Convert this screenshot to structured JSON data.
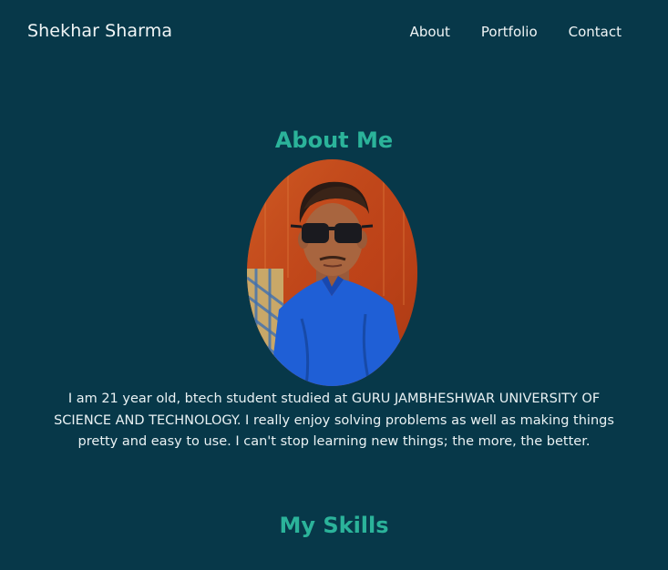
{
  "nav": {
    "brand": "Shekhar Sharma",
    "links": [
      "About",
      "Portfolio",
      "Contact"
    ]
  },
  "about": {
    "title": "About Me",
    "photo_alt": "Profile photo",
    "text": "I am 21 year old, btech student studied at GURU JAMBHESHWAR UNIVERSITY OF SCIENCE AND TECHNOLOGY. I really enjoy solving problems as well as making things pretty and easy to use. I can't stop learning new things; the more, the better."
  },
  "skills": {
    "title": "My Skills"
  },
  "colors": {
    "background": "#073849",
    "accent": "#2bb39a",
    "text": "#eaf2f4"
  }
}
